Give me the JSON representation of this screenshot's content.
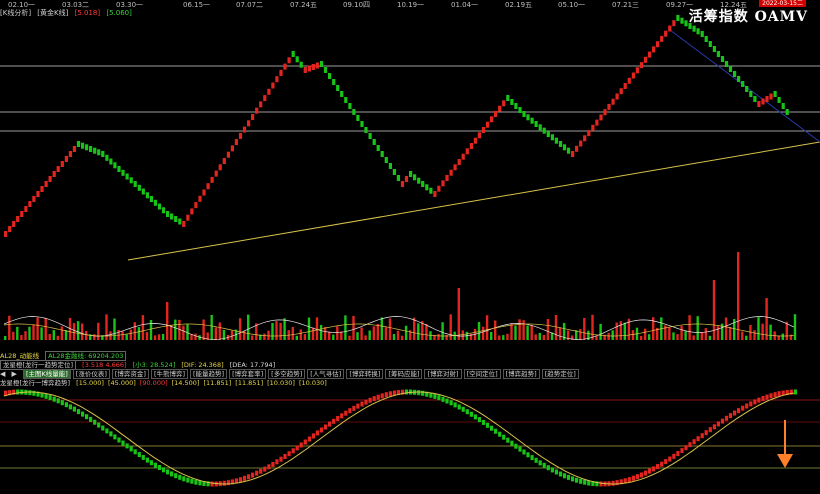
{
  "dates": [
    "02.10一",
    "03.03二",
    "03.30一",
    "06.15一",
    "07.07二",
    "07.24五",
    "09.10四",
    "10.19一",
    "01.04一",
    "02.19五",
    "05.10一",
    "07.21三",
    "09.27一",
    "12.24五"
  ],
  "toolbar": {
    "k_analysis": "[K线分析]",
    "product": "[黄金K线]",
    "value_red": "[5.018]",
    "value_green": "[5.060]"
  },
  "brand": "活筹指数  OAMV",
  "date_badge": "2022-03-15二",
  "volume_indicator": {
    "name": "AL28_动能线",
    "line1": "AL28金融线: 69204.203"
  },
  "indicator1": {
    "name": "龙星橙[龙行一趋势定位]",
    "values": [
      {
        "text": "[3.518 4.666]",
        "color": "red"
      },
      {
        "text": "[小3: 28.524]",
        "color": "green"
      },
      {
        "text": "[DIF: 24.368]",
        "color": "yellow"
      },
      {
        "text": "[DEA: 17.794]",
        "color": "white"
      }
    ]
  },
  "tabs": {
    "prev": "◀",
    "next": "▶",
    "items": [
      "[主图K线量能]",
      "[涨价仪表]",
      "[博弈资金]",
      "[牛熊博弈]",
      "[能量趋势]",
      "[博弈套率]",
      "[多空趋势]",
      "[人气寻估]",
      "[博弈转换]",
      "[筹码应能]",
      "[博弈对射]",
      "[空间定位]",
      "[博弈趋势]",
      "[趋势定位]"
    ]
  },
  "indicator2": {
    "name": "龙星橙[龙行一博弈趋势]",
    "params": [
      {
        "text": "[15.000]",
        "color": "yellow"
      },
      {
        "text": "[45.000]",
        "color": "yellow"
      },
      {
        "text": "[90.000]",
        "color": "red"
      },
      {
        "text": "[14.500]",
        "color": "yellow"
      },
      {
        "text": "[11.851]",
        "color": "yellow"
      },
      {
        "text": "[11.851]",
        "color": "yellow"
      },
      {
        "text": "[10.030]",
        "color": "yellow"
      },
      {
        "text": "[10.030]",
        "color": "yellow"
      }
    ]
  },
  "colors": {
    "up": "#e3251f",
    "down": "#19c419",
    "trend": "#d8c34a",
    "downtrend": "#2a3aa8",
    "signal": "#ff7f2a"
  },
  "price_chart": {
    "waypoints": [
      [
        0,
        0.1
      ],
      [
        18,
        0.55
      ],
      [
        24,
        0.5
      ],
      [
        40,
        0.2
      ],
      [
        44,
        0.15
      ],
      [
        71,
        1.0
      ],
      [
        74,
        0.92
      ],
      [
        78,
        0.95
      ],
      [
        98,
        0.35
      ],
      [
        100,
        0.4
      ],
      [
        106,
        0.3
      ],
      [
        124,
        0.78
      ],
      [
        128,
        0.7
      ],
      [
        140,
        0.5
      ],
      [
        166,
        1.18
      ],
      [
        172,
        1.1
      ],
      [
        180,
        0.9
      ],
      [
        186,
        0.75
      ],
      [
        190,
        0.8
      ],
      [
        194,
        0.68
      ]
    ]
  }
}
